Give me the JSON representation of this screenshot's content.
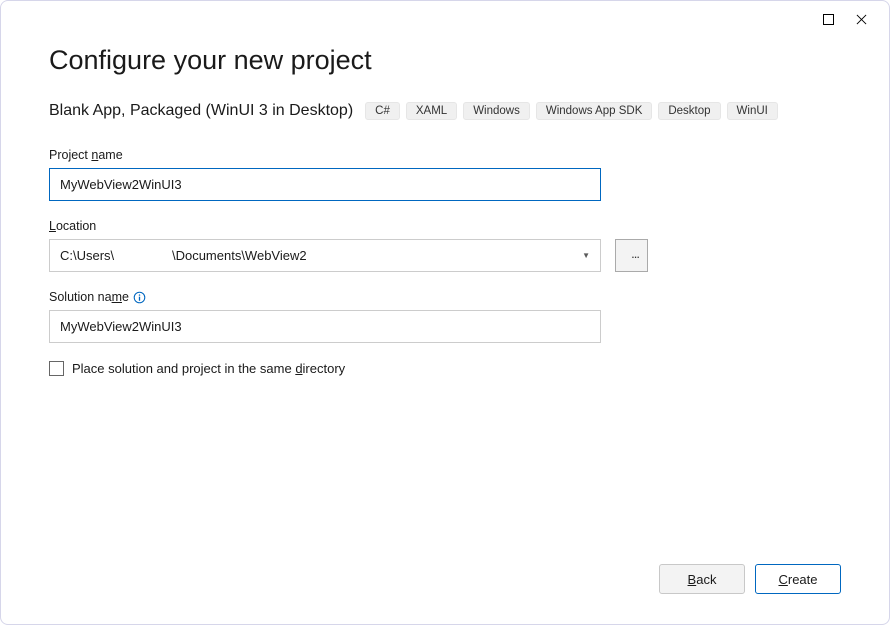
{
  "window": {
    "title": "Configure your new project"
  },
  "template": {
    "name": "Blank App, Packaged (WinUI 3 in Desktop)",
    "tags": [
      "C#",
      "XAML",
      "Windows",
      "Windows App SDK",
      "Desktop",
      "WinUI"
    ]
  },
  "fields": {
    "projectName": {
      "label_pre": "Project ",
      "label_mn": "n",
      "label_post": "ame",
      "value": "MyWebView2WinUI3"
    },
    "location": {
      "label_mn": "L",
      "label_post": "ocation",
      "path_seg1": "C:\\Users\\",
      "path_seg2": "                \\Documents\\WebView2",
      "browse": "..."
    },
    "solutionName": {
      "label_pre": "Solution na",
      "label_mn": "m",
      "label_post": "e",
      "value": "MyWebView2WinUI3"
    },
    "sameDirectory": {
      "label_pre": "Place solution and project in the same ",
      "label_mn": "d",
      "label_post": "irectory",
      "checked": false
    }
  },
  "footer": {
    "back_mn": "B",
    "back_post": "ack",
    "create_mn": "C",
    "create_post": "reate"
  }
}
